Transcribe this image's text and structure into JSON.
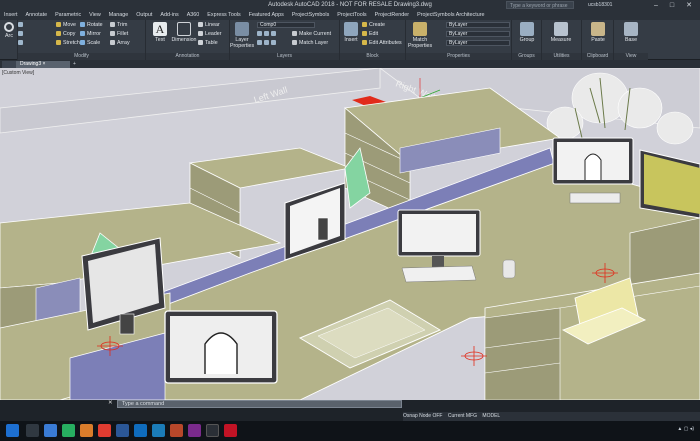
{
  "window": {
    "title": "Autodesk AutoCAD 2018 - NOT FOR RESALE   Drawing3.dwg",
    "search_placeholder": "Type a keyword or phrase",
    "user": "ucsb18301"
  },
  "menus": [
    "Insert",
    "Annotate",
    "Parametric",
    "View",
    "Manage",
    "Output",
    "Add-ins",
    "A360",
    "Express Tools",
    "Featured Apps",
    "ProjectSymbols",
    "ProjectTools",
    "ProjectRender",
    "ProjectSymbols Architecture"
  ],
  "ribbon": {
    "draw_tools": [
      "Arc"
    ],
    "modify_tools": [
      "Move",
      "Rotate",
      "Trim",
      "Copy",
      "Mirror",
      "Fillet",
      "Stretch",
      "Scale",
      "Array"
    ],
    "modify_label": "Modify",
    "annotation_tools": [
      "Text",
      "Dimension",
      "Linear",
      "Leader",
      "Table"
    ],
    "annotation_label": "Annotation",
    "layers_tools": [
      "Layer Properties",
      "Comp0",
      "Make Current",
      "Match Layer"
    ],
    "layers_label": "Layers",
    "block_tools": [
      "Insert",
      "Create",
      "Edit",
      "Edit Attributes"
    ],
    "block_label": "Block",
    "properties_tools": [
      "Match Properties",
      "ByLayer",
      "ByLayer",
      "ByLayer"
    ],
    "properties_label": "Properties",
    "groups_tools": [
      "Group"
    ],
    "groups_label": "Groups",
    "utilities_tools": [
      "Measure"
    ],
    "utilities_label": "Utilities",
    "clipboard_tools": [
      "Paste"
    ],
    "clipboard_label": "Clipboard",
    "view_tools": [
      "Base"
    ],
    "view_label": "View"
  },
  "tabs": {
    "start": "",
    "drawing": "Drawing3"
  },
  "viewport": {
    "label": "[Custom View]",
    "left_wall": "Left Wall",
    "right_wall": "Right Wall"
  },
  "command": {
    "placeholder": "Type a command"
  },
  "status": [
    "Osnap Node OFF",
    "Current MFG",
    "MODEL"
  ],
  "colors": {
    "floor": "#d1d1d9",
    "desk": "#b4b38a",
    "panel": "#7c7fb7",
    "accent": "#e12b1a"
  }
}
